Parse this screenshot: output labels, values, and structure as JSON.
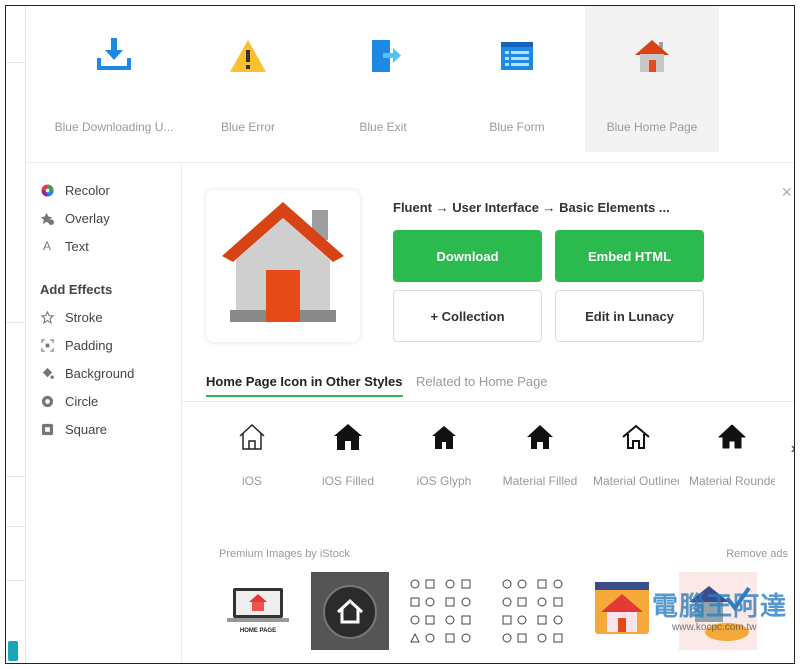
{
  "top_icons": [
    {
      "label": "Blue Downloading U...",
      "icon": "download-tray-icon"
    },
    {
      "label": "Blue Error",
      "icon": "warning-triangle-icon"
    },
    {
      "label": "Blue Exit",
      "icon": "exit-door-icon"
    },
    {
      "label": "Blue Form",
      "icon": "form-icon"
    },
    {
      "label": "Blue Home Page",
      "icon": "home-icon"
    }
  ],
  "sidebar": {
    "items": [
      {
        "label": "Recolor",
        "icon": "color-wheel-icon"
      },
      {
        "label": "Overlay",
        "icon": "overlay-icon"
      },
      {
        "label": "Text",
        "icon": "text-icon"
      }
    ],
    "effects_heading": "Add Effects",
    "effects": [
      {
        "label": "Stroke",
        "icon": "star-outline-icon"
      },
      {
        "label": "Padding",
        "icon": "padding-icon"
      },
      {
        "label": "Background",
        "icon": "paint-bucket-icon"
      },
      {
        "label": "Circle",
        "icon": "circle-icon"
      },
      {
        "label": "Square",
        "icon": "square-icon"
      }
    ]
  },
  "detail": {
    "breadcrumb": "Fluent → User Interface → Basic Elements ...",
    "download_label": "Download",
    "embed_label": "Embed HTML",
    "collection_label": "+ Collection",
    "lunacy_label": "Edit in Lunacy",
    "close_glyph": "×"
  },
  "tabs": [
    {
      "label": "Home Page Icon in Other Styles",
      "active": true
    },
    {
      "label": "Related to Home Page",
      "active": false
    }
  ],
  "styles": [
    {
      "label": "iOS",
      "icon": "home-outline-icon"
    },
    {
      "label": "iOS Filled",
      "icon": "home-filled-icon"
    },
    {
      "label": "iOS Glyph",
      "icon": "home-glyph-icon"
    },
    {
      "label": "Material Filled",
      "icon": "home-material-filled-icon"
    },
    {
      "label": "Material Outlined",
      "icon": "home-material-outline-icon"
    },
    {
      "label": "Material Rounded",
      "icon": "home-material-rounded-icon"
    }
  ],
  "premium": {
    "label": "Premium Images by iStock",
    "remove_ads": "Remove ads",
    "thumb1_caption": "HOME PAGE"
  },
  "watermark": {
    "text": "電腦王阿達",
    "url": "www.kocpc.com.tw"
  },
  "colors": {
    "accent_green": "#2aba4e",
    "house_roof": "#d84315",
    "house_body": "#c8c8c8",
    "house_door": "#e64a19",
    "icon_blue": "#1e88e5",
    "warning_yellow": "#fbc02d"
  }
}
